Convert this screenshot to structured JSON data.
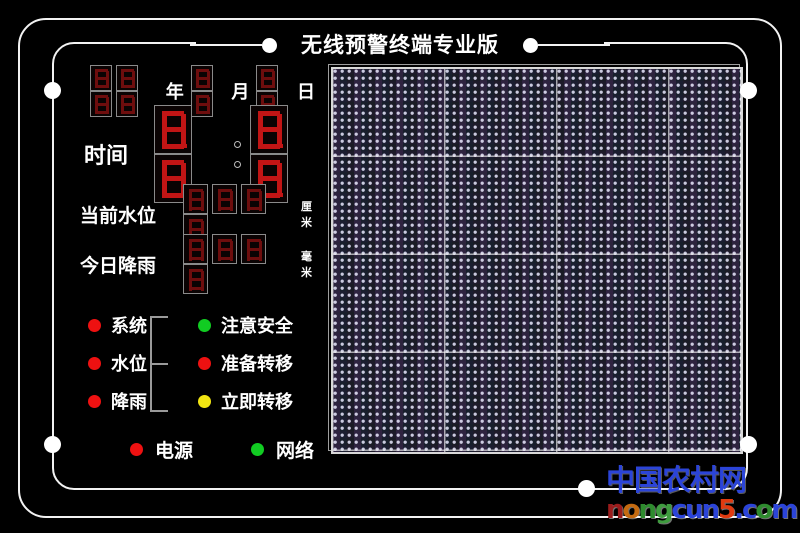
{
  "device": {
    "title": "无线预警终端专业版"
  },
  "datetime": {
    "year_digits": [
      "8",
      "8",
      "8",
      "8"
    ],
    "year_label": "年",
    "month_digits": [
      "8",
      "8"
    ],
    "month_label": "月",
    "day_digits": [
      "8",
      "8"
    ],
    "day_label": "日",
    "time_label": "时间",
    "hour_digits": [
      "8",
      "8"
    ],
    "minute_digits": [
      "8",
      "8"
    ],
    "colon": ":"
  },
  "readings": [
    {
      "label": "当前水位",
      "digits": [
        "8",
        "8",
        "8",
        "8"
      ],
      "unit": "厘米"
    },
    {
      "label": "今日降雨",
      "digits": [
        "8",
        "8",
        "8",
        "8"
      ],
      "unit": "毫米"
    }
  ],
  "indicators": {
    "left_column": [
      {
        "label": "系统",
        "color": "#ee1111",
        "state": "red"
      },
      {
        "label": "水位",
        "color": "#ee1111",
        "state": "red"
      },
      {
        "label": "降雨",
        "color": "#ee1111",
        "state": "red"
      }
    ],
    "right_column": [
      {
        "label": "注意安全",
        "color": "#11cc22",
        "state": "green"
      },
      {
        "label": "准备转移",
        "color": "#ee1111",
        "state": "red"
      },
      {
        "label": "立即转移",
        "color": "#f2e512",
        "state": "yellow"
      }
    ]
  },
  "status_row": [
    {
      "label": "电源",
      "color": "#ee1111",
      "state": "red"
    },
    {
      "label": "网络",
      "color": "#11cc22",
      "state": "green"
    }
  ],
  "watermark": {
    "cn": "中国农村网",
    "en_letters": [
      {
        "ch": "n",
        "color": "#9a1c1c"
      },
      {
        "ch": "o",
        "color": "#c46a10"
      },
      {
        "ch": "n",
        "color": "#2e8b2e"
      },
      {
        "ch": "g",
        "color": "#3f9b3f"
      },
      {
        "ch": "c",
        "color": "#2b44d8"
      },
      {
        "ch": "u",
        "color": "#2b44d8"
      },
      {
        "ch": "n",
        "color": "#2b44d8"
      },
      {
        "ch": "5",
        "color": "#e03a10"
      },
      {
        "ch": ".",
        "color": "#2b44d8"
      },
      {
        "ch": "c",
        "color": "#2b44d8"
      },
      {
        "ch": "o",
        "color": "#2e8b2e"
      },
      {
        "ch": "m",
        "color": "#2b44d8"
      }
    ]
  },
  "colors": {
    "frame": "#f2f2f2",
    "segment_dim": "#6e0d0d",
    "segment_bright": "#c21515",
    "led_red": "#ee1111",
    "led_green": "#11cc22",
    "led_yellow": "#f2e512",
    "matrix_border": "#d8d8d8",
    "watermark_blue": "#2b44d8"
  }
}
